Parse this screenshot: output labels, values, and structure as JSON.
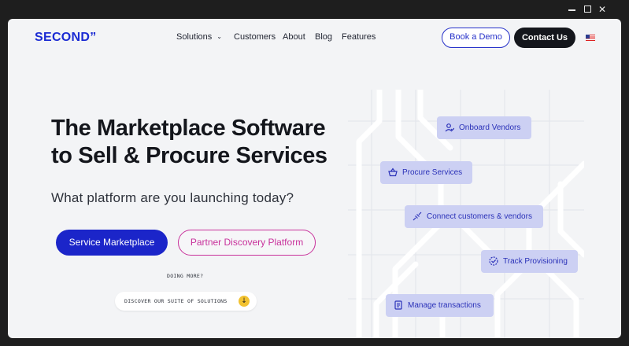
{
  "window": {
    "minimize_icon": "minimize-icon",
    "maximize_icon": "maximize-icon",
    "close_icon": "close-icon"
  },
  "header": {
    "logo": "SECOND”",
    "nav": {
      "solutions": "Solutions",
      "customers": "Customers",
      "about": "About",
      "blog": "Blog",
      "features": "Features"
    },
    "book_demo": "Book a Demo",
    "contact_us": "Contact Us",
    "language_flag": "us-flag-icon"
  },
  "hero": {
    "title": "The Marketplace Software to Sell & Procure Services",
    "subtitle": "What platform are you launching today?",
    "primary_button": "Service Marketplace",
    "secondary_button": "Partner Discovery Platform",
    "doing_more": "DOING MORE?",
    "discover": "DISCOVER OUR SUITE OF SOLUTIONS"
  },
  "features": {
    "onboard": "Onboard Vendors",
    "procure": "Procure Services",
    "connect": "Connect customers & vendors",
    "track": "Track Provisioning",
    "manage": "Manage transactions"
  },
  "colors": {
    "brand": "#1b2bd3",
    "primary_button": "#1b25c9",
    "accent_pink": "#c8319b",
    "pill_bg": "#ccd0f3",
    "dark_button": "#14161c",
    "discover_badge": "#f2c230"
  }
}
